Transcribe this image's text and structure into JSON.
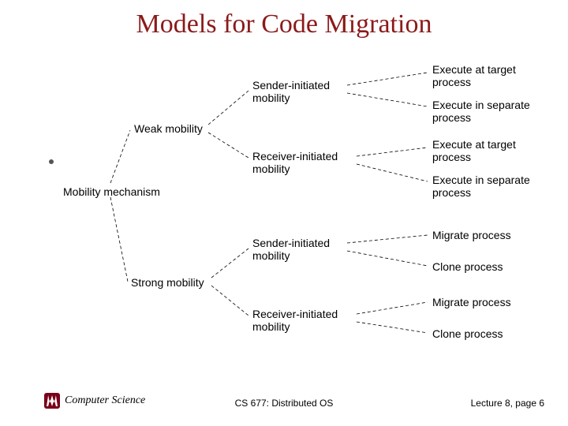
{
  "title": "Models for Code Migration",
  "tree": {
    "root": "Mobility mechanism",
    "weak": {
      "label": "Weak mobility",
      "sender": "Sender-initiated mobility",
      "receiver": "Receiver-initiated mobility",
      "leaves": {
        "exec_target_1": "Execute at target process",
        "exec_sep_1": "Execute in separate process",
        "exec_target_2": "Execute at target process",
        "exec_sep_2": "Execute in separate process"
      }
    },
    "strong": {
      "label": "Strong mobility",
      "sender": "Sender-initiated mobility",
      "receiver": "Receiver-initiated mobility",
      "leaves": {
        "migrate_1": "Migrate process",
        "clone_1": "Clone process",
        "migrate_2": "Migrate process",
        "clone_2": "Clone process"
      }
    }
  },
  "footer": {
    "dept": "Computer Science",
    "course": "CS 677: Distributed OS",
    "lecture": "Lecture 8, page 6"
  }
}
